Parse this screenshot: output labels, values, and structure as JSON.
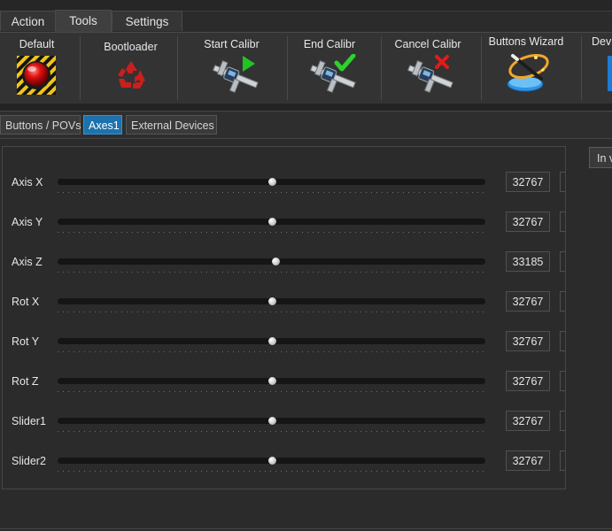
{
  "menu": {
    "tabs": [
      {
        "label": "Action"
      },
      {
        "label": "Tools"
      },
      {
        "label": "Settings"
      }
    ],
    "active": "Tools"
  },
  "toolbar": {
    "items": [
      {
        "label": "Default",
        "icon": "alarm-button-icon"
      },
      {
        "label": "Bootloader",
        "icon": "recycle-icon"
      },
      {
        "label": "Start Calibr",
        "icon": "caliper-play-icon"
      },
      {
        "label": "End Calibr",
        "icon": "caliper-check-icon"
      },
      {
        "label": "Cancel Calibr",
        "icon": "caliper-cancel-icon"
      },
      {
        "label": "Buttons Wizard",
        "icon": "magic-wand-icon"
      },
      {
        "label": "Devi",
        "icon": "device-icon"
      }
    ]
  },
  "subtabs": {
    "items": [
      {
        "label": "Buttons / POVs"
      },
      {
        "label": "Axes1"
      },
      {
        "label": "External Devices"
      }
    ],
    "active": "Axes1"
  },
  "axes": [
    {
      "label": "Axis X",
      "value": "32767",
      "level": 0.5
    },
    {
      "label": "Axis Y",
      "value": "32767",
      "level": 0.5
    },
    {
      "label": "Axis Z",
      "value": "33185",
      "level": 0.509
    },
    {
      "label": "Rot X",
      "value": "32767",
      "level": 0.5
    },
    {
      "label": "Rot Y",
      "value": "32767",
      "level": 0.5
    },
    {
      "label": "Rot Z",
      "value": "32767",
      "level": 0.5
    },
    {
      "label": "Slider1",
      "value": "32767",
      "level": 0.5
    },
    {
      "label": "Slider2",
      "value": "32767",
      "level": 0.5
    }
  ],
  "side_button": {
    "label": "In v"
  },
  "colors": {
    "background": "#2b2b2b",
    "accent": "#1d72ad",
    "track": "#151515"
  }
}
